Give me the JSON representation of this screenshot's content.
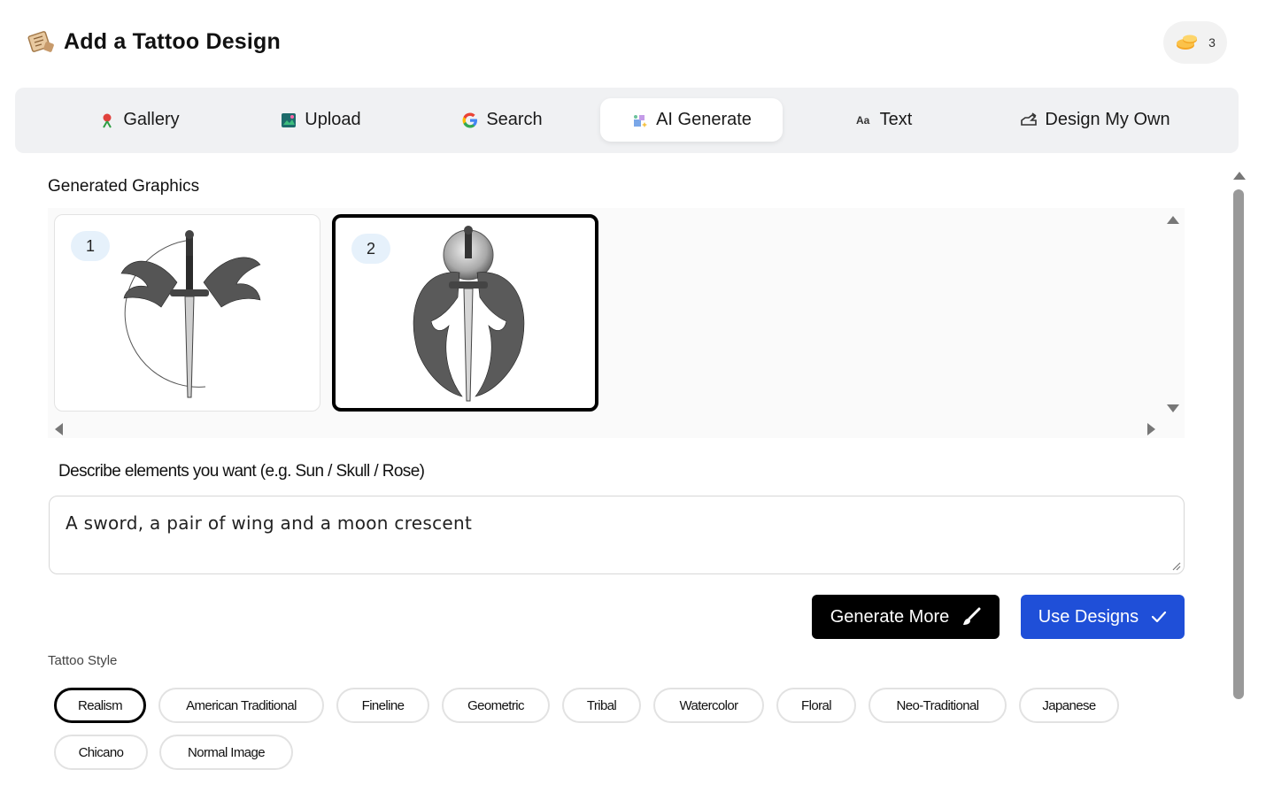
{
  "header": {
    "title": "Add a Tattoo Design",
    "title_icon": "scroll-map-icon",
    "credits_icon": "coins-icon",
    "credits_count": "3"
  },
  "tabs": [
    {
      "label": "Gallery",
      "icon": "pin-icon",
      "active": false
    },
    {
      "label": "Upload",
      "icon": "upload-image-icon",
      "active": false
    },
    {
      "label": "Search",
      "icon": "google-g-icon",
      "active": false
    },
    {
      "label": "AI Generate",
      "icon": "ai-sparkle-icon",
      "active": true
    },
    {
      "label": "Text",
      "icon": "font-aa-icon",
      "active": false
    },
    {
      "label": "Design My Own",
      "icon": "hand-draw-icon",
      "active": false
    }
  ],
  "generated": {
    "label": "Generated Graphics",
    "items": [
      {
        "number": "1",
        "selected": false,
        "description": "sword with wings and moon"
      },
      {
        "number": "2",
        "selected": true,
        "description": "sword with wings and full moon"
      }
    ]
  },
  "prompt": {
    "label": "Describe elements you want (e.g. Sun / Skull / Rose)",
    "value": "A sword, a pair of wing and a moon crescent"
  },
  "buttons": {
    "generate_more": "Generate More",
    "use_designs": "Use Designs"
  },
  "styles": {
    "label": "Tattoo Style",
    "options": [
      "Realism",
      "American Traditional",
      "Fineline",
      "Geometric",
      "Tribal",
      "Watercolor",
      "Floral",
      "Neo-Traditional",
      "Japanese",
      "Chicano",
      "Normal Image"
    ],
    "selected": "Realism"
  },
  "colors": {
    "primary_blue": "#1f4fd8",
    "black": "#000000",
    "tab_bg": "#f0f1f3",
    "badge_bg": "#e6f1fb"
  }
}
